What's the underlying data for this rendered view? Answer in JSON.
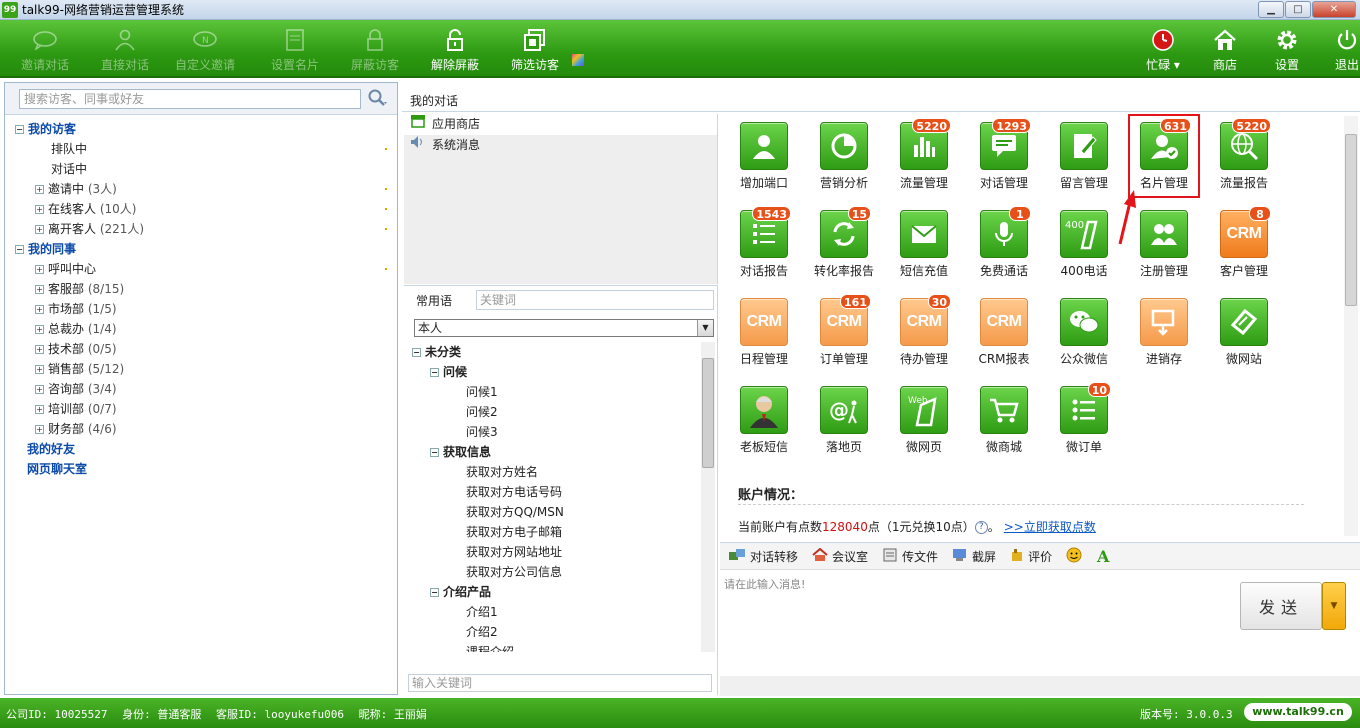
{
  "window": {
    "app_icon": "99",
    "title": "talk99-网络营销运营管理系统",
    "min": "▁",
    "max": "□",
    "close": "✕"
  },
  "toolbar": {
    "items": [
      {
        "label": "邀请对话",
        "icon": "chat-bubble-icon"
      },
      {
        "label": "直接对话",
        "icon": "person-icon"
      },
      {
        "label": "自定义邀请",
        "icon": "custom-bubble-icon"
      },
      {
        "label": "设置名片",
        "icon": "card-icon"
      },
      {
        "label": "屏蔽访客",
        "icon": "lock-icon"
      },
      {
        "label": "解除屏蔽",
        "icon": "unlock-icon"
      },
      {
        "label": "筛选访客",
        "icon": "filter-icon"
      }
    ],
    "right": [
      {
        "label": "忙碌 ▾",
        "icon": "status-clock-icon"
      },
      {
        "label": "商店",
        "icon": "house-icon"
      },
      {
        "label": "设置",
        "icon": "gear-icon"
      },
      {
        "label": "退出",
        "icon": "power-icon"
      }
    ]
  },
  "left": {
    "search_placeholder": "搜索访客、同事或好友",
    "tree": [
      {
        "label": "我的访客",
        "group": true,
        "exp": "−"
      },
      {
        "label": "排队中",
        "count": "",
        "leaf": true
      },
      {
        "label": "对话中",
        "count": "",
        "leaf": true
      },
      {
        "label": "邀请中",
        "count": "(3人)",
        "exp": "+"
      },
      {
        "label": "在线客人",
        "count": "(10人)",
        "exp": "+"
      },
      {
        "label": "离开客人",
        "count": "(221人)",
        "exp": "+"
      },
      {
        "label": "我的同事",
        "group": true,
        "exp": "−"
      },
      {
        "label": "呼叫中心",
        "count": "",
        "exp": "+"
      },
      {
        "label": "客服部",
        "count": "(8/15)",
        "exp": "+"
      },
      {
        "label": "市场部",
        "count": "(1/5)",
        "exp": "+"
      },
      {
        "label": "总裁办",
        "count": "(1/4)",
        "exp": "+"
      },
      {
        "label": "技术部",
        "count": "(0/5)",
        "exp": "+"
      },
      {
        "label": "销售部",
        "count": "(5/12)",
        "exp": "+"
      },
      {
        "label": "咨询部",
        "count": "(3/4)",
        "exp": "+"
      },
      {
        "label": "培训部",
        "count": "(0/7)",
        "exp": "+"
      },
      {
        "label": "财务部",
        "count": "(4/6)",
        "exp": "+"
      },
      {
        "label": "我的好友",
        "group": true,
        "exp": ""
      },
      {
        "label": "网页聊天室",
        "group": true,
        "exp": ""
      }
    ]
  },
  "conversation": {
    "header": "我的对话",
    "list": [
      {
        "label": "应用商店",
        "icon": "store-icon"
      },
      {
        "label": "系统消息",
        "icon": "speaker-icon"
      }
    ]
  },
  "phrases": {
    "label": "常用语",
    "keyword_placeholder": "关键词",
    "select_value": "本人",
    "footer_placeholder": "输入关键词",
    "tree": [
      {
        "label": "未分类",
        "lvl": 0,
        "exp": "−",
        "cat": true
      },
      {
        "label": "问候",
        "lvl": 1,
        "exp": "−",
        "cat": true
      },
      {
        "label": "问候1",
        "lvl": 2
      },
      {
        "label": "问候2",
        "lvl": 2
      },
      {
        "label": "问候3",
        "lvl": 2
      },
      {
        "label": "获取信息",
        "lvl": 1,
        "exp": "−",
        "cat": true
      },
      {
        "label": "获取对方姓名",
        "lvl": 2
      },
      {
        "label": "获取对方电话号码",
        "lvl": 2
      },
      {
        "label": "获取对方QQ/MSN",
        "lvl": 2
      },
      {
        "label": "获取对方电子邮箱",
        "lvl": 2
      },
      {
        "label": "获取对方网站地址",
        "lvl": 2
      },
      {
        "label": "获取对方公司信息",
        "lvl": 2
      },
      {
        "label": "介绍产品",
        "lvl": 1,
        "exp": "−",
        "cat": true
      },
      {
        "label": "介绍1",
        "lvl": 2
      },
      {
        "label": "介绍2",
        "lvl": 2
      },
      {
        "label": "课程介绍",
        "lvl": 2
      }
    ]
  },
  "apps": [
    {
      "label": "增加端口",
      "badge": "",
      "icon": "user-add-icon",
      "style": "green"
    },
    {
      "label": "营销分析",
      "badge": "",
      "icon": "pie-chart-icon",
      "style": "green"
    },
    {
      "label": "流量管理",
      "badge": "5220",
      "icon": "bar-chart-icon",
      "style": "green"
    },
    {
      "label": "对话管理",
      "badge": "1293",
      "icon": "message-icon",
      "style": "green"
    },
    {
      "label": "留言管理",
      "badge": "",
      "icon": "note-edit-icon",
      "style": "green"
    },
    {
      "label": "名片管理",
      "badge": "631",
      "icon": "user-check-icon",
      "style": "green"
    },
    {
      "label": "流量报告",
      "badge": "5220",
      "icon": "globe-search-icon",
      "style": "green"
    },
    {
      "label": "对话报告",
      "badge": "1543",
      "icon": "list-icon",
      "style": "green"
    },
    {
      "label": "转化率报告",
      "badge": "15",
      "icon": "refresh-icon",
      "style": "green"
    },
    {
      "label": "短信充值",
      "badge": "",
      "icon": "envelope-icon",
      "style": "green"
    },
    {
      "label": "免费通话",
      "badge": "1",
      "icon": "microphone-icon",
      "style": "green"
    },
    {
      "label": "400电话",
      "badge": "",
      "icon": "phone-400-icon",
      "style": "green"
    },
    {
      "label": "注册管理",
      "badge": "",
      "icon": "users-icon",
      "style": "green"
    },
    {
      "label": "客户管理",
      "badge": "8",
      "icon": "crm-icon",
      "style": "orange"
    },
    {
      "label": "日程管理",
      "badge": "",
      "icon": "crm-icon",
      "style": "lightorange"
    },
    {
      "label": "订单管理",
      "badge": "161",
      "icon": "crm-icon",
      "style": "lightorange"
    },
    {
      "label": "待办管理",
      "badge": "30",
      "icon": "crm-icon",
      "style": "lightorange"
    },
    {
      "label": "CRM报表",
      "badge": "",
      "icon": "crm-icon",
      "style": "lightorange"
    },
    {
      "label": "公众微信",
      "badge": "",
      "icon": "wechat-icon",
      "style": "green"
    },
    {
      "label": "进销存",
      "badge": "",
      "icon": "inventory-icon",
      "style": "lightorange"
    },
    {
      "label": "微网站",
      "badge": "",
      "icon": "mobile-site-icon",
      "style": "green"
    },
    {
      "label": "老板短信",
      "badge": "",
      "icon": "boss-avatar-icon",
      "style": "green"
    },
    {
      "label": "落地页",
      "badge": "",
      "icon": "landing-icon",
      "style": "green"
    },
    {
      "label": "微网页",
      "badge": "",
      "icon": "web-mobile-icon",
      "style": "green"
    },
    {
      "label": "微商城",
      "badge": "",
      "icon": "cart-icon",
      "style": "green"
    },
    {
      "label": "微订单",
      "badge": "10",
      "icon": "order-list-icon",
      "style": "green"
    }
  ],
  "crm_text": "CRM",
  "web_text": "Web",
  "phone_text": "400",
  "account": {
    "title": "账户情况：",
    "prefix": "当前账户有点数",
    "points": "128040",
    "suffix": "点（1元兑换10点）",
    "qmark": "?",
    "after": "。",
    "link": ">>立即获取点数"
  },
  "chat_tools": [
    {
      "label": "对话转移",
      "icon": "transfer-icon"
    },
    {
      "label": "会议室",
      "icon": "meeting-house-icon"
    },
    {
      "label": "传文件",
      "icon": "file-icon"
    },
    {
      "label": "截屏",
      "icon": "screenshot-icon"
    },
    {
      "label": "评价",
      "icon": "rating-icon"
    },
    {
      "label": "",
      "icon": "smiley-icon"
    },
    {
      "label": "",
      "icon": "font-a-icon"
    }
  ],
  "chat": {
    "placeholder": "请在此输入消息!",
    "send": "发送",
    "send_drop": "▼"
  },
  "status": {
    "company": "公司ID: 10025527",
    "role": "身份: 普通客服",
    "service_id": "客服ID: looyukefu006",
    "nickname": "昵称: 王丽娟",
    "version": "版本号: 3.0.0.3",
    "url": "www.talk99.cn"
  },
  "colors": {
    "toolbar_green": "#2d9a12",
    "badge": "#e8501a",
    "highlight": "#e3141a",
    "group_blue": "#0b4aa8"
  }
}
